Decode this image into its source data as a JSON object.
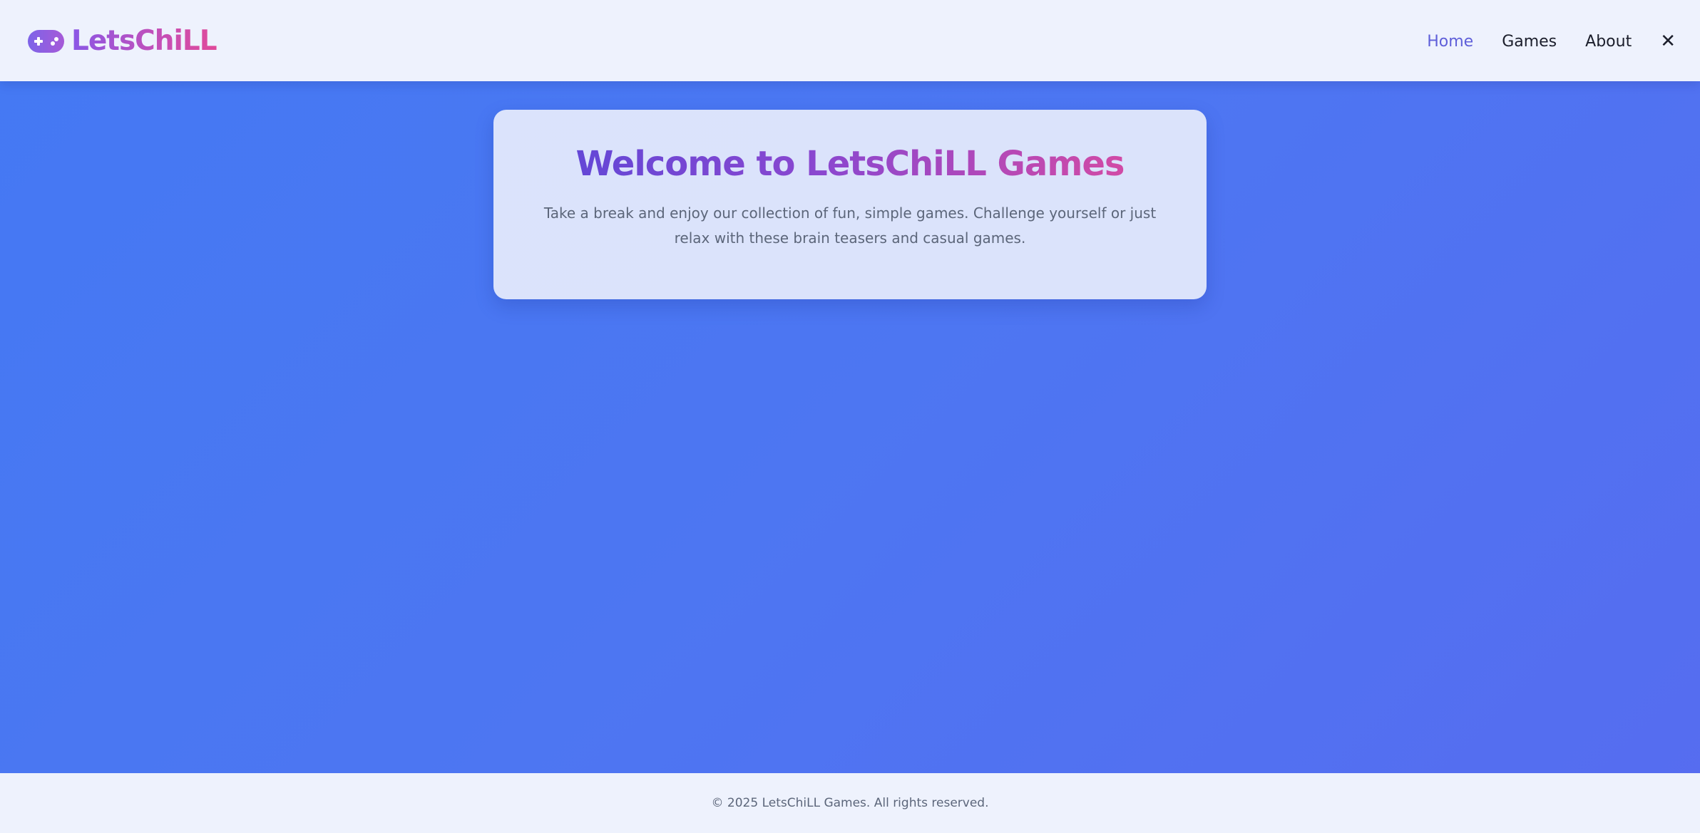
{
  "header": {
    "brand": "LetsChiLL",
    "brand_icon": "gamepad-icon",
    "nav": [
      {
        "label": "Home",
        "active": true
      },
      {
        "label": "Games",
        "active": false
      },
      {
        "label": "About",
        "active": false
      }
    ],
    "close_icon": "close-icon",
    "close_glyph": "✕"
  },
  "welcome": {
    "title": "Welcome to LetsChiLL Games",
    "description": "Take a break and enjoy our collection of fun, simple games. Challenge yourself or just relax with these brain teasers and casual games."
  },
  "footer": {
    "copyright": "© 2025 LetsChiLL Games. All rights reserved."
  },
  "colors": {
    "background_start": "#4479f3",
    "background_end": "#566cf0",
    "nav_active": "#5f5fd9",
    "brand_gradient_start": "#8a57e6",
    "brand_gradient_end": "#e04a9a"
  }
}
